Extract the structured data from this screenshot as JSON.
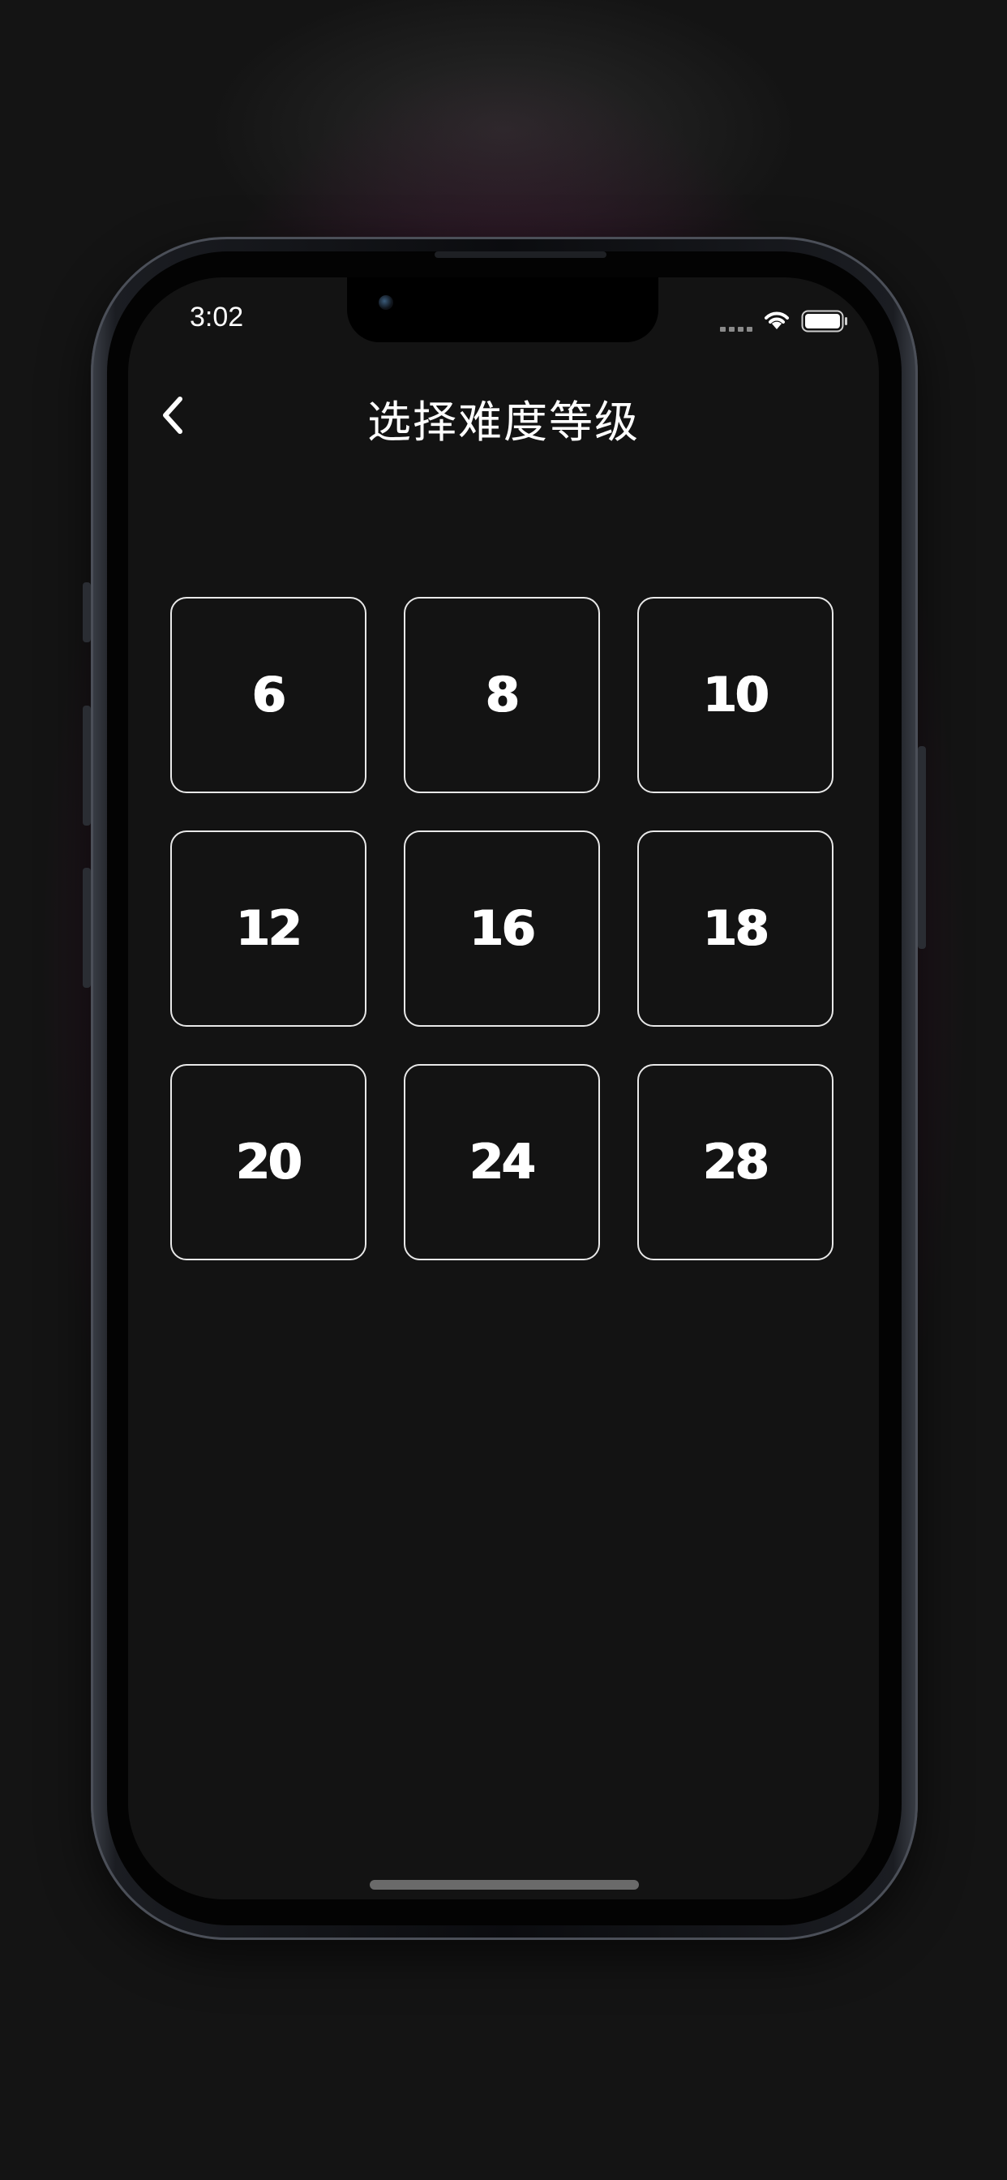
{
  "status_bar": {
    "time": "3:02"
  },
  "header": {
    "title": "选择难度等级"
  },
  "levels": [
    "6",
    "8",
    "10",
    "12",
    "16",
    "18",
    "20",
    "24",
    "28"
  ],
  "colors": {
    "background": "#131313",
    "accent_glow": "#6e1850",
    "text": "#ffffff",
    "border": "#e8e8e8"
  },
  "icons": {
    "back": "chevron-left-icon",
    "wifi": "wifi-icon",
    "battery": "battery-icon",
    "signal": "cellular-signal-icon"
  }
}
